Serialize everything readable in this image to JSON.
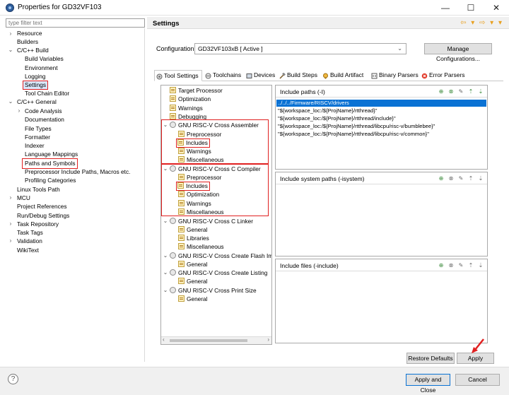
{
  "window": {
    "title": "Properties for GD32VF103",
    "minimize": "—",
    "maximize": "☐",
    "close": "✕"
  },
  "filter": {
    "placeholder": "type filter text"
  },
  "nav": [
    {
      "label": "Resource",
      "twisty": "›"
    },
    {
      "label": "Builders",
      "twisty": ""
    },
    {
      "label": "C/C++ Build",
      "twisty": "⌄"
    },
    {
      "label": "Build Variables",
      "twisty": ""
    },
    {
      "label": "Environment",
      "twisty": ""
    },
    {
      "label": "Logging",
      "twisty": ""
    },
    {
      "label": "Settings",
      "twisty": ""
    },
    {
      "label": "Tool Chain Editor",
      "twisty": ""
    },
    {
      "label": "C/C++ General",
      "twisty": "⌄"
    },
    {
      "label": "Code Analysis",
      "twisty": "›"
    },
    {
      "label": "Documentation",
      "twisty": ""
    },
    {
      "label": "File Types",
      "twisty": ""
    },
    {
      "label": "Formatter",
      "twisty": ""
    },
    {
      "label": "Indexer",
      "twisty": ""
    },
    {
      "label": "Language Mappings",
      "twisty": ""
    },
    {
      "label": "Paths and Symbols",
      "twisty": ""
    },
    {
      "label": "Preprocessor Include Paths, Macros etc.",
      "twisty": ""
    },
    {
      "label": "Profiling Categories",
      "twisty": ""
    },
    {
      "label": "Linux Tools Path",
      "twisty": ""
    },
    {
      "label": "MCU",
      "twisty": "›"
    },
    {
      "label": "Project References",
      "twisty": ""
    },
    {
      "label": "Run/Debug Settings",
      "twisty": ""
    },
    {
      "label": "Task Repository",
      "twisty": "›"
    },
    {
      "label": "Task Tags",
      "twisty": ""
    },
    {
      "label": "Validation",
      "twisty": "›"
    },
    {
      "label": "WikiText",
      "twisty": ""
    }
  ],
  "header": {
    "title": "Settings",
    "nav_icons": "⇦ ▾ ⇨ ▾ ▾"
  },
  "config": {
    "label": "Configuration:",
    "value": "GD32VF103xB  [ Active ]",
    "arrow": "⌄",
    "manage_label": "Manage Configurations..."
  },
  "tabs": [
    {
      "label": "Tool Settings"
    },
    {
      "label": "Toolchains"
    },
    {
      "label": "Devices"
    },
    {
      "label": "Build Steps"
    },
    {
      "label": "Build Artifact"
    },
    {
      "label": "Binary Parsers"
    },
    {
      "label": "Error Parsers"
    }
  ],
  "tool_tree": [
    {
      "label": "Target Processor",
      "twisty": ""
    },
    {
      "label": "Optimization",
      "twisty": ""
    },
    {
      "label": "Warnings",
      "twisty": ""
    },
    {
      "label": "Debugging",
      "twisty": ""
    },
    {
      "label": "GNU RISC-V Cross Assembler",
      "twisty": "⌄"
    },
    {
      "label": "Preprocessor",
      "twisty": ""
    },
    {
      "label": "Includes",
      "twisty": ""
    },
    {
      "label": "Warnings",
      "twisty": ""
    },
    {
      "label": "Miscellaneous",
      "twisty": ""
    },
    {
      "label": "GNU RISC-V Cross C Compiler",
      "twisty": "⌄"
    },
    {
      "label": "Preprocessor",
      "twisty": ""
    },
    {
      "label": "Includes",
      "twisty": ""
    },
    {
      "label": "Optimization",
      "twisty": ""
    },
    {
      "label": "Warnings",
      "twisty": ""
    },
    {
      "label": "Miscellaneous",
      "twisty": ""
    },
    {
      "label": "GNU RISC-V Cross C Linker",
      "twisty": "⌄"
    },
    {
      "label": "General",
      "twisty": ""
    },
    {
      "label": "Libraries",
      "twisty": ""
    },
    {
      "label": "Miscellaneous",
      "twisty": ""
    },
    {
      "label": "GNU RISC-V Cross Create Flash Imag",
      "twisty": "⌄"
    },
    {
      "label": "General",
      "twisty": ""
    },
    {
      "label": "GNU RISC-V Cross Create Listing",
      "twisty": "⌄"
    },
    {
      "label": "General",
      "twisty": ""
    },
    {
      "label": "GNU RISC-V Cross Print Size",
      "twisty": "⌄"
    },
    {
      "label": "General",
      "twisty": ""
    }
  ],
  "scroll": {
    "left": "‹",
    "right": "›"
  },
  "include_paths": {
    "label": "Include paths (-I)",
    "items": [
      "../../../Firmware/RISCV/drivers",
      "\"${workspace_loc:/${ProjName}/rtthread}\"",
      "\"${workspace_loc:/${ProjName}/rtthread/include}\"",
      "\"${workspace_loc:/${ProjName}/rtthread/libcpu/risc-v/bumblebee}\"",
      "\"${workspace_loc:/${ProjName}/rtthread/libcpu/risc-v/common}\""
    ]
  },
  "system_paths": {
    "label": "Include system paths (-isystem)"
  },
  "include_files": {
    "label": "Include files (-include)"
  },
  "panel_icons": {
    "add": "⊕",
    "delete": "⊗",
    "edit": "✎",
    "up": "⇡",
    "down": "⇣"
  },
  "buttons": {
    "restore_defaults": "Restore Defaults",
    "apply": "Apply",
    "apply_close": "Apply and Close",
    "cancel": "Cancel",
    "help": "?"
  },
  "colors": {
    "accent": "#0a72d4",
    "highlight": "#e02020"
  }
}
